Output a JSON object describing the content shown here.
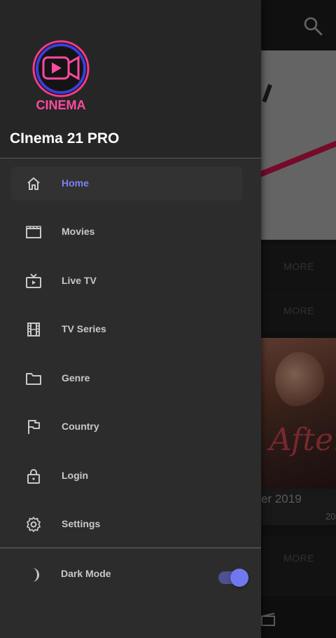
{
  "app": {
    "name": "CInema 21 PRO",
    "logo_text": "CINEMA"
  },
  "background": {
    "more_labels": [
      "MORE",
      "MORE",
      "MORE"
    ],
    "featured_title": "er 2019",
    "featured_year": "20",
    "poster_art_text": "After"
  },
  "menu": {
    "items": [
      {
        "label": "Home",
        "icon": "home-icon",
        "active": true
      },
      {
        "label": "Movies",
        "icon": "clapperboard-icon",
        "active": false
      },
      {
        "label": "Live TV",
        "icon": "tv-play-icon",
        "active": false
      },
      {
        "label": "TV Series",
        "icon": "film-strip-icon",
        "active": false
      },
      {
        "label": "Genre",
        "icon": "folder-icon",
        "active": false
      },
      {
        "label": "Country",
        "icon": "flag-icon",
        "active": false
      },
      {
        "label": "Login",
        "icon": "lock-icon",
        "active": false
      },
      {
        "label": "Settings",
        "icon": "gear-icon",
        "active": false
      }
    ]
  },
  "dark_mode": {
    "label": "Dark Mode",
    "icon": "moon-icon",
    "enabled": true
  },
  "colors": {
    "accent": "#7b83f2",
    "drawer_bg": "#2c2c2c",
    "text": "#c8c8c8"
  }
}
